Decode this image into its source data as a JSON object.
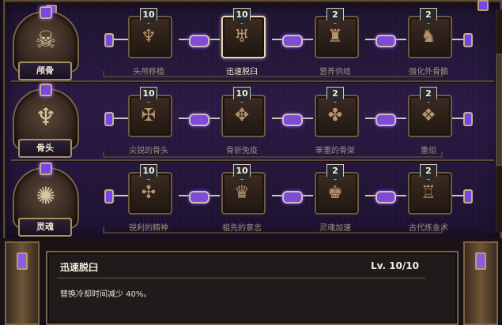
{
  "rows": [
    {
      "tree_name": "颅骨",
      "portrait_icon": "skull-icon",
      "nodes": [
        {
          "label": "头颅移植",
          "level": "10",
          "icon": "skull-transplant-icon",
          "selected": false
        },
        {
          "label": "迅速脱臼",
          "level": "10",
          "icon": "dislocate-icon",
          "selected": true
        },
        {
          "label": "营养供给",
          "level": "2",
          "icon": "nutrition-icon",
          "selected": false
        },
        {
          "label": "强化外骨骼",
          "level": "2",
          "icon": "exoskeleton-icon",
          "selected": false
        }
      ]
    },
    {
      "tree_name": "骨头",
      "portrait_icon": "bone-icon",
      "nodes": [
        {
          "label": "尖锐的骨头",
          "level": "10",
          "icon": "sharp-bone-icon",
          "selected": false
        },
        {
          "label": "骨折免疫",
          "level": "10",
          "icon": "fracture-immunity-icon",
          "selected": false
        },
        {
          "label": "笨重的骨架",
          "level": "2",
          "icon": "heavy-skeleton-icon",
          "selected": false
        },
        {
          "label": "重组",
          "level": "2",
          "icon": "reassemble-icon",
          "selected": false
        }
      ]
    },
    {
      "tree_name": "灵魂",
      "portrait_icon": "soul-icon",
      "nodes": [
        {
          "label": "锐利的精神",
          "level": "10",
          "icon": "sharp-spirit-icon",
          "selected": false
        },
        {
          "label": "祖先的意志",
          "level": "10",
          "icon": "ancestor-will-icon",
          "selected": false
        },
        {
          "label": "灵魂加速",
          "level": "2",
          "icon": "soul-acceleration-icon",
          "selected": false
        },
        {
          "label": "古代炼金术",
          "level": "2",
          "icon": "alchemy-icon",
          "selected": false
        }
      ]
    }
  ],
  "detail": {
    "title": "迅速脱臼",
    "level": "Lv. 10/10",
    "description": "替换冷却时间减少 40%。"
  },
  "colors": {
    "accent_purple": "#7f4bd8",
    "frame_gold": "#a88f62",
    "panel_bg": "#2a1a45"
  }
}
